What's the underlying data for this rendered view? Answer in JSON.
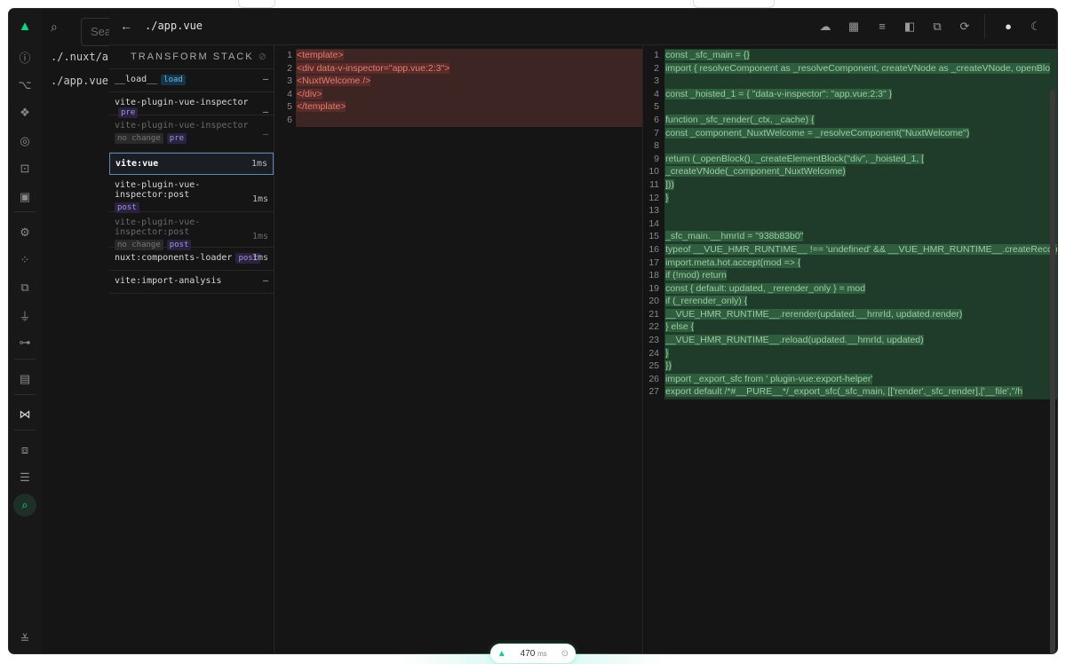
{
  "app": {
    "accent": "#00dc82"
  },
  "rail_icons": [
    "nuxt-logo-icon",
    "search-icon",
    "info-icon",
    "components-tree-icon",
    "components-icon",
    "imports-icon",
    "pages-icon",
    "images-icon",
    "settings-icon",
    "modules-icon",
    "assets-icon",
    "plugins-icon",
    "server-routes-icon",
    "storage-icon",
    "vscode-icon",
    "terminal-icon",
    "runtime-configs-icon",
    "inspect-icon",
    "devtools-settings-icon"
  ],
  "modules": {
    "search_placeholder": "Sea",
    "items": [
      "./.nuxt/app",
      "./app.vue"
    ]
  },
  "topbar": {
    "path": "./app.vue"
  },
  "stack": {
    "title": "TRANSFORM STACK",
    "steps": [
      {
        "name": "__load__",
        "tag": "load",
        "time": "–"
      },
      {
        "name": "vite-plugin-vue-inspector",
        "tag": "pre",
        "time": "–"
      },
      {
        "name": "vite-plugin-vue-inspector",
        "sub": "no change",
        "tag": "pre",
        "time": "–"
      },
      {
        "name": "vite:vue",
        "tag": "",
        "time": "1ms"
      },
      {
        "name": "vite-plugin-vue-inspector:post",
        "tag": "post",
        "time": "1ms"
      },
      {
        "name": "vite-plugin-vue-inspector:post",
        "sub": "no change",
        "tag": "post",
        "time": "1ms"
      },
      {
        "name": "nuxt:components-loader",
        "tag": "post",
        "time": "1ms"
      },
      {
        "name": "vite:import-analysis",
        "tag": "",
        "time": "–"
      }
    ]
  },
  "left_code": [
    "<template>",
    "  <div data-v-inspector=\"app.vue:2:3\">",
    "    <NuxtWelcome />",
    "  </div>",
    "</template>",
    ""
  ],
  "right_code": [
    "const _sfc_main = {}",
    "import { resolveComponent as _resolveComponent, createVNode as _createVNode, openBlo",
    "",
    "const _hoisted_1 = { \"data-v-inspector\": \"app.vue:2:3\" }",
    "",
    "function _sfc_render(_ctx, _cache) {",
    "  const _component_NuxtWelcome = _resolveComponent(\"NuxtWelcome\")",
    "",
    "  return (_openBlock(), _createElementBlock(\"div\", _hoisted_1, [",
    "    _createVNode(_component_NuxtWelcome)",
    "  ]))",
    "}",
    "",
    "",
    "_sfc_main.__hmrId = \"938b83b0\"",
    "typeof __VUE_HMR_RUNTIME__ !== 'undefined' && __VUE_HMR_RUNTIME__.createRecord",
    "import.meta.hot.accept(mod => {",
    "  if (!mod) return",
    "  const { default: updated, _rerender_only } = mod",
    "  if (_rerender_only) {",
    "    __VUE_HMR_RUNTIME__.rerender(updated.__hmrId, updated.render)",
    "  } else {",
    "    __VUE_HMR_RUNTIME__.reload(updated.__hmrId, updated)",
    "  }",
    "})",
    "import _export_sfc from ' plugin-vue:export-helper'",
    "export default /*#__PURE__*/_export_sfc(_sfc_main, [['render',_sfc_render],['__file',\"/h"
  ],
  "badge": {
    "value": "470",
    "unit": "ms"
  }
}
